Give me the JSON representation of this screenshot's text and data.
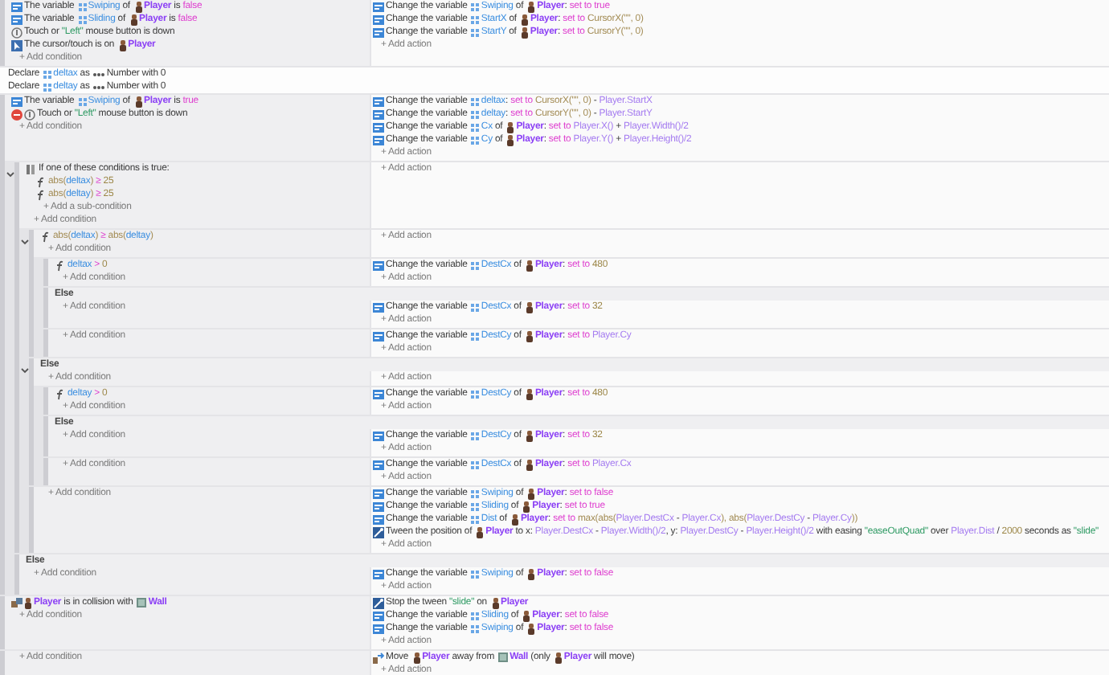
{
  "events": [
    {
      "conditions": [
        {
          "kind": "variable",
          "segments": [
            {
              "kind": "text",
              "text": "The variable "
            },
            {
              "kind": "var",
              "text": "Swiping"
            },
            {
              "kind": "text",
              "text": " of "
            },
            {
              "kind": "sprite",
              "text": "Player"
            },
            {
              "kind": "text",
              "text": " is "
            },
            {
              "kind": "kw",
              "text": "false"
            }
          ]
        },
        {
          "kind": "variable",
          "segments": [
            {
              "kind": "text",
              "text": "The variable "
            },
            {
              "kind": "var",
              "text": "Sliding"
            },
            {
              "kind": "text",
              "text": " of "
            },
            {
              "kind": "sprite",
              "text": "Player"
            },
            {
              "kind": "text",
              "text": " is "
            },
            {
              "kind": "kw",
              "text": "false"
            }
          ]
        },
        {
          "kind": "touch",
          "segments": [
            {
              "kind": "text",
              "text": "Touch or "
            },
            {
              "kind": "str",
              "text": "\"Left\""
            },
            {
              "kind": "text",
              "text": " mouse button is down"
            }
          ]
        },
        {
          "kind": "cursor",
          "segments": [
            {
              "kind": "text",
              "text": "The cursor/touch is on "
            },
            {
              "kind": "sprite",
              "text": "Player"
            }
          ]
        }
      ],
      "add_condition": "+ Add condition",
      "actions": [
        {
          "kind": "variable",
          "segments": [
            {
              "kind": "text",
              "text": "Change the variable "
            },
            {
              "kind": "var",
              "text": "Swiping"
            },
            {
              "kind": "text",
              "text": " of "
            },
            {
              "kind": "sprite",
              "text": "Player"
            },
            {
              "kind": "text",
              "text": ": "
            },
            {
              "kind": "kw",
              "text": "set to true"
            }
          ]
        },
        {
          "kind": "variable",
          "segments": [
            {
              "kind": "text",
              "text": "Change the variable "
            },
            {
              "kind": "var",
              "text": "StartX"
            },
            {
              "kind": "text",
              "text": " of "
            },
            {
              "kind": "sprite",
              "text": "Player"
            },
            {
              "kind": "text",
              "text": ": "
            },
            {
              "kind": "kw",
              "text": "set to "
            },
            {
              "kind": "expr",
              "text": "CursorX(\"\", 0)"
            }
          ]
        },
        {
          "kind": "variable",
          "segments": [
            {
              "kind": "text",
              "text": "Change the variable "
            },
            {
              "kind": "var",
              "text": "StartY"
            },
            {
              "kind": "text",
              "text": " of "
            },
            {
              "kind": "sprite",
              "text": "Player"
            },
            {
              "kind": "text",
              "text": ": "
            },
            {
              "kind": "kw",
              "text": "set to "
            },
            {
              "kind": "expr",
              "text": "CursorY(\"\", 0)"
            }
          ]
        }
      ],
      "add_action": "+ Add action"
    },
    {
      "local_variables": [
        {
          "segments": [
            {
              "kind": "text",
              "text": "Declare "
            },
            {
              "kind": "var",
              "text": "deltax"
            },
            {
              "kind": "text",
              "text": " as "
            },
            {
              "kind": "type",
              "text": "Number"
            },
            {
              "kind": "text",
              "text": " with 0"
            }
          ]
        },
        {
          "segments": [
            {
              "kind": "text",
              "text": "Declare "
            },
            {
              "kind": "var",
              "text": "deltay"
            },
            {
              "kind": "text",
              "text": " as "
            },
            {
              "kind": "type",
              "text": "Number"
            },
            {
              "kind": "text",
              "text": " with 0"
            }
          ]
        }
      ],
      "conditions": [
        {
          "kind": "variable",
          "segments": [
            {
              "kind": "text",
              "text": "The variable "
            },
            {
              "kind": "var",
              "text": "Swiping"
            },
            {
              "kind": "text",
              "text": " of "
            },
            {
              "kind": "sprite",
              "text": "Player"
            },
            {
              "kind": "text",
              "text": " is "
            },
            {
              "kind": "kw",
              "text": "true"
            }
          ]
        },
        {
          "kind": "touch",
          "inverted": true,
          "segments": [
            {
              "kind": "text",
              "text": "Touch or "
            },
            {
              "kind": "str",
              "text": "\"Left\""
            },
            {
              "kind": "text",
              "text": " mouse button is down"
            }
          ]
        }
      ],
      "add_condition": "+ Add condition",
      "actions": [
        {
          "kind": "variable",
          "segments": [
            {
              "kind": "text",
              "text": "Change the variable "
            },
            {
              "kind": "var",
              "text": "deltax"
            },
            {
              "kind": "text",
              "text": ": "
            },
            {
              "kind": "kw",
              "text": "set to "
            },
            {
              "kind": "expr",
              "text": "CursorX(\"\", 0)"
            },
            {
              "kind": "text",
              "text": " - "
            },
            {
              "kind": "ref",
              "text": "Player.StartX"
            }
          ]
        },
        {
          "kind": "variable",
          "segments": [
            {
              "kind": "text",
              "text": "Change the variable "
            },
            {
              "kind": "var",
              "text": "deltay"
            },
            {
              "kind": "text",
              "text": ": "
            },
            {
              "kind": "kw",
              "text": "set to "
            },
            {
              "kind": "expr",
              "text": "CursorY(\"\", 0)"
            },
            {
              "kind": "text",
              "text": " - "
            },
            {
              "kind": "ref",
              "text": "Player.StartY"
            }
          ]
        },
        {
          "kind": "variable",
          "segments": [
            {
              "kind": "text",
              "text": "Change the variable "
            },
            {
              "kind": "var",
              "text": "Cx"
            },
            {
              "kind": "text",
              "text": " of "
            },
            {
              "kind": "sprite",
              "text": "Player"
            },
            {
              "kind": "text",
              "text": ": "
            },
            {
              "kind": "kw",
              "text": "set to "
            },
            {
              "kind": "ref",
              "text": "Player.X()"
            },
            {
              "kind": "text",
              "text": " + "
            },
            {
              "kind": "ref",
              "text": "Player.Width()/2"
            }
          ]
        },
        {
          "kind": "variable",
          "segments": [
            {
              "kind": "text",
              "text": "Change the variable "
            },
            {
              "kind": "var",
              "text": "Cy"
            },
            {
              "kind": "text",
              "text": " of "
            },
            {
              "kind": "sprite",
              "text": "Player"
            },
            {
              "kind": "text",
              "text": ": "
            },
            {
              "kind": "kw",
              "text": "set to "
            },
            {
              "kind": "ref",
              "text": "Player.Y()"
            },
            {
              "kind": "text",
              "text": " + "
            },
            {
              "kind": "ref",
              "text": "Player.Height()/2"
            }
          ]
        }
      ],
      "add_action": "+ Add action",
      "children": [
        {
          "expanded": true,
          "conditions": [
            {
              "kind": "or",
              "segments": [
                {
                  "kind": "text",
                  "text": "If one of these conditions is true:"
                }
              ],
              "sub_conditions": [
                {
                  "kind": "function",
                  "segments": [
                    {
                      "kind": "expr",
                      "text": "abs("
                    },
                    {
                      "kind": "name",
                      "text": "deltax"
                    },
                    {
                      "kind": "expr",
                      "text": ")"
                    },
                    {
                      "kind": "op",
                      "text": " ≥ "
                    },
                    {
                      "kind": "num",
                      "text": "25"
                    }
                  ]
                },
                {
                  "kind": "function",
                  "segments": [
                    {
                      "kind": "expr",
                      "text": "abs("
                    },
                    {
                      "kind": "name",
                      "text": "deltay"
                    },
                    {
                      "kind": "expr",
                      "text": ")"
                    },
                    {
                      "kind": "op",
                      "text": " ≥ "
                    },
                    {
                      "kind": "num",
                      "text": "25"
                    }
                  ]
                }
              ],
              "add_sub_condition": "+ Add a sub-condition"
            }
          ],
          "add_condition": "+ Add condition",
          "add_action": "+ Add action",
          "children": [
            {
              "expanded": true,
              "conditions": [
                {
                  "kind": "function",
                  "segments": [
                    {
                      "kind": "expr",
                      "text": "abs("
                    },
                    {
                      "kind": "name",
                      "text": "deltax"
                    },
                    {
                      "kind": "expr",
                      "text": ")"
                    },
                    {
                      "kind": "op",
                      "text": " ≥ "
                    },
                    {
                      "kind": "expr",
                      "text": "abs("
                    },
                    {
                      "kind": "name",
                      "text": "deltay"
                    },
                    {
                      "kind": "expr",
                      "text": ")"
                    }
                  ]
                }
              ],
              "add_condition": "+ Add condition",
              "add_action": "+ Add action",
              "children": [
                {
                  "conditions": [
                    {
                      "kind": "function",
                      "segments": [
                        {
                          "kind": "name",
                          "text": "deltax"
                        },
                        {
                          "kind": "op",
                          "text": " > "
                        },
                        {
                          "kind": "num",
                          "text": "0"
                        }
                      ]
                    }
                  ],
                  "add_condition": "+ Add condition",
                  "actions": [
                    {
                      "kind": "variable",
                      "segments": [
                        {
                          "kind": "text",
                          "text": "Change the variable "
                        },
                        {
                          "kind": "var",
                          "text": "DestCx"
                        },
                        {
                          "kind": "text",
                          "text": " of "
                        },
                        {
                          "kind": "sprite",
                          "text": "Player"
                        },
                        {
                          "kind": "text",
                          "text": ": "
                        },
                        {
                          "kind": "kw",
                          "text": "set to "
                        },
                        {
                          "kind": "num",
                          "text": "480"
                        }
                      ]
                    }
                  ],
                  "add_action": "+ Add action"
                },
                {
                  "label": "Else",
                  "add_condition": "+ Add condition",
                  "actions": [
                    {
                      "kind": "variable",
                      "segments": [
                        {
                          "kind": "text",
                          "text": "Change the variable "
                        },
                        {
                          "kind": "var",
                          "text": "DestCx"
                        },
                        {
                          "kind": "text",
                          "text": " of "
                        },
                        {
                          "kind": "sprite",
                          "text": "Player"
                        },
                        {
                          "kind": "text",
                          "text": ": "
                        },
                        {
                          "kind": "kw",
                          "text": "set to "
                        },
                        {
                          "kind": "num",
                          "text": "32"
                        }
                      ]
                    }
                  ],
                  "add_action": "+ Add action"
                },
                {
                  "add_condition": "+ Add condition",
                  "actions": [
                    {
                      "kind": "variable",
                      "segments": [
                        {
                          "kind": "text",
                          "text": "Change the variable "
                        },
                        {
                          "kind": "var",
                          "text": "DestCy"
                        },
                        {
                          "kind": "text",
                          "text": " of "
                        },
                        {
                          "kind": "sprite",
                          "text": "Player"
                        },
                        {
                          "kind": "text",
                          "text": ": "
                        },
                        {
                          "kind": "kw",
                          "text": "set to "
                        },
                        {
                          "kind": "ref",
                          "text": "Player.Cy"
                        }
                      ]
                    }
                  ],
                  "add_action": "+ Add action"
                }
              ]
            },
            {
              "expanded": true,
              "label": "Else",
              "add_condition": "+ Add condition",
              "add_action": "+ Add action",
              "children": [
                {
                  "conditions": [
                    {
                      "kind": "function",
                      "segments": [
                        {
                          "kind": "name",
                          "text": "deltay"
                        },
                        {
                          "kind": "op",
                          "text": " > "
                        },
                        {
                          "kind": "num",
                          "text": "0"
                        }
                      ]
                    }
                  ],
                  "add_condition": "+ Add condition",
                  "actions": [
                    {
                      "kind": "variable",
                      "segments": [
                        {
                          "kind": "text",
                          "text": "Change the variable "
                        },
                        {
                          "kind": "var",
                          "text": "DestCy"
                        },
                        {
                          "kind": "text",
                          "text": " of "
                        },
                        {
                          "kind": "sprite",
                          "text": "Player"
                        },
                        {
                          "kind": "text",
                          "text": ": "
                        },
                        {
                          "kind": "kw",
                          "text": "set to "
                        },
                        {
                          "kind": "num",
                          "text": "480"
                        }
                      ]
                    }
                  ],
                  "add_action": "+ Add action"
                },
                {
                  "label": "Else",
                  "add_condition": "+ Add condition",
                  "actions": [
                    {
                      "kind": "variable",
                      "segments": [
                        {
                          "kind": "text",
                          "text": "Change the variable "
                        },
                        {
                          "kind": "var",
                          "text": "DestCy"
                        },
                        {
                          "kind": "text",
                          "text": " of "
                        },
                        {
                          "kind": "sprite",
                          "text": "Player"
                        },
                        {
                          "kind": "text",
                          "text": ": "
                        },
                        {
                          "kind": "kw",
                          "text": "set to "
                        },
                        {
                          "kind": "num",
                          "text": "32"
                        }
                      ]
                    }
                  ],
                  "add_action": "+ Add action"
                },
                {
                  "add_condition": "+ Add condition",
                  "actions": [
                    {
                      "kind": "variable",
                      "segments": [
                        {
                          "kind": "text",
                          "text": "Change the variable "
                        },
                        {
                          "kind": "var",
                          "text": "DestCx"
                        },
                        {
                          "kind": "text",
                          "text": " of "
                        },
                        {
                          "kind": "sprite",
                          "text": "Player"
                        },
                        {
                          "kind": "text",
                          "text": ": "
                        },
                        {
                          "kind": "kw",
                          "text": "set to "
                        },
                        {
                          "kind": "ref",
                          "text": "Player.Cx"
                        }
                      ]
                    }
                  ],
                  "add_action": "+ Add action"
                }
              ]
            },
            {
              "add_condition": "+ Add condition",
              "actions": [
                {
                  "kind": "variable",
                  "segments": [
                    {
                      "kind": "text",
                      "text": "Change the variable "
                    },
                    {
                      "kind": "var",
                      "text": "Swiping"
                    },
                    {
                      "kind": "text",
                      "text": " of "
                    },
                    {
                      "kind": "sprite",
                      "text": "Player"
                    },
                    {
                      "kind": "text",
                      "text": ": "
                    },
                    {
                      "kind": "kw",
                      "text": "set to false"
                    }
                  ]
                },
                {
                  "kind": "variable",
                  "segments": [
                    {
                      "kind": "text",
                      "text": "Change the variable "
                    },
                    {
                      "kind": "var",
                      "text": "Sliding"
                    },
                    {
                      "kind": "text",
                      "text": " of "
                    },
                    {
                      "kind": "sprite",
                      "text": "Player"
                    },
                    {
                      "kind": "text",
                      "text": ": "
                    },
                    {
                      "kind": "kw",
                      "text": "set to true"
                    }
                  ]
                },
                {
                  "kind": "variable",
                  "segments": [
                    {
                      "kind": "text",
                      "text": "Change the variable "
                    },
                    {
                      "kind": "var",
                      "text": "Dist"
                    },
                    {
                      "kind": "text",
                      "text": " of "
                    },
                    {
                      "kind": "sprite",
                      "text": "Player"
                    },
                    {
                      "kind": "text",
                      "text": ": "
                    },
                    {
                      "kind": "kw",
                      "text": "set to "
                    },
                    {
                      "kind": "expr",
                      "text": "max(abs("
                    },
                    {
                      "kind": "ref",
                      "text": "Player.DestCx"
                    },
                    {
                      "kind": "text",
                      "text": " - "
                    },
                    {
                      "kind": "ref",
                      "text": "Player.Cx"
                    },
                    {
                      "kind": "expr",
                      "text": "), abs("
                    },
                    {
                      "kind": "ref",
                      "text": "Player.DestCy"
                    },
                    {
                      "kind": "text",
                      "text": " - "
                    },
                    {
                      "kind": "ref",
                      "text": "Player.Cy"
                    },
                    {
                      "kind": "expr",
                      "text": "))"
                    }
                  ]
                },
                {
                  "kind": "tween",
                  "segments": [
                    {
                      "kind": "text",
                      "text": "Tween the position of "
                    },
                    {
                      "kind": "sprite",
                      "text": "Player"
                    },
                    {
                      "kind": "text",
                      "text": " to x: "
                    },
                    {
                      "kind": "ref",
                      "text": "Player.DestCx"
                    },
                    {
                      "kind": "text",
                      "text": " - "
                    },
                    {
                      "kind": "ref",
                      "text": "Player.Width()/2"
                    },
                    {
                      "kind": "text",
                      "text": ", y: "
                    },
                    {
                      "kind": "ref",
                      "text": "Player.DestCy"
                    },
                    {
                      "kind": "text",
                      "text": " - "
                    },
                    {
                      "kind": "ref",
                      "text": "Player.Height()/2"
                    },
                    {
                      "kind": "text",
                      "text": " with easing "
                    },
                    {
                      "kind": "str",
                      "text": "\"easeOutQuad\""
                    },
                    {
                      "kind": "text",
                      "text": " over "
                    },
                    {
                      "kind": "ref",
                      "text": "Player.Dist"
                    },
                    {
                      "kind": "text",
                      "text": " / "
                    },
                    {
                      "kind": "num",
                      "text": "2000"
                    },
                    {
                      "kind": "text",
                      "text": " seconds as "
                    },
                    {
                      "kind": "str",
                      "text": "\"slide\""
                    }
                  ]
                }
              ],
              "add_action": "+ Add action"
            }
          ]
        },
        {
          "label": "Else",
          "add_condition": "+ Add condition",
          "actions": [
            {
              "kind": "variable",
              "segments": [
                {
                  "kind": "text",
                  "text": "Change the variable "
                },
                {
                  "kind": "var",
                  "text": "Swiping"
                },
                {
                  "kind": "text",
                  "text": " of "
                },
                {
                  "kind": "sprite",
                  "text": "Player"
                },
                {
                  "kind": "text",
                  "text": ": "
                },
                {
                  "kind": "kw",
                  "text": "set to false"
                }
              ]
            }
          ],
          "add_action": "+ Add action"
        }
      ]
    },
    {
      "conditions": [
        {
          "kind": "collision",
          "segments": [
            {
              "kind": "sprite",
              "text": "Player"
            },
            {
              "kind": "text",
              "text": " is in collision with "
            },
            {
              "kind": "tiled",
              "text": "Wall"
            }
          ]
        }
      ],
      "add_condition": "+ Add condition",
      "actions": [
        {
          "kind": "tween",
          "segments": [
            {
              "kind": "text",
              "text": "Stop the tween "
            },
            {
              "kind": "str",
              "text": "\"slide\""
            },
            {
              "kind": "text",
              "text": " on "
            },
            {
              "kind": "sprite",
              "text": "Player"
            }
          ]
        },
        {
          "kind": "variable",
          "segments": [
            {
              "kind": "text",
              "text": "Change the variable "
            },
            {
              "kind": "var",
              "text": "Sliding"
            },
            {
              "kind": "text",
              "text": " of "
            },
            {
              "kind": "sprite",
              "text": "Player"
            },
            {
              "kind": "text",
              "text": ": "
            },
            {
              "kind": "kw",
              "text": "set to false"
            }
          ]
        },
        {
          "kind": "variable",
          "segments": [
            {
              "kind": "text",
              "text": "Change the variable "
            },
            {
              "kind": "var",
              "text": "Swiping"
            },
            {
              "kind": "text",
              "text": " of "
            },
            {
              "kind": "sprite",
              "text": "Player"
            },
            {
              "kind": "text",
              "text": ": "
            },
            {
              "kind": "kw",
              "text": "set to false"
            }
          ]
        }
      ],
      "add_action": "+ Add action"
    },
    {
      "add_condition": "+ Add condition",
      "actions": [
        {
          "kind": "move",
          "segments": [
            {
              "kind": "text",
              "text": "Move "
            },
            {
              "kind": "sprite",
              "text": "Player"
            },
            {
              "kind": "text",
              "text": " away from "
            },
            {
              "kind": "tiled",
              "text": "Wall"
            },
            {
              "kind": "text",
              "text": " (only "
            },
            {
              "kind": "sprite",
              "text": "Player"
            },
            {
              "kind": "text",
              "text": " will move)"
            }
          ]
        }
      ],
      "add_action": "+ Add action"
    }
  ]
}
